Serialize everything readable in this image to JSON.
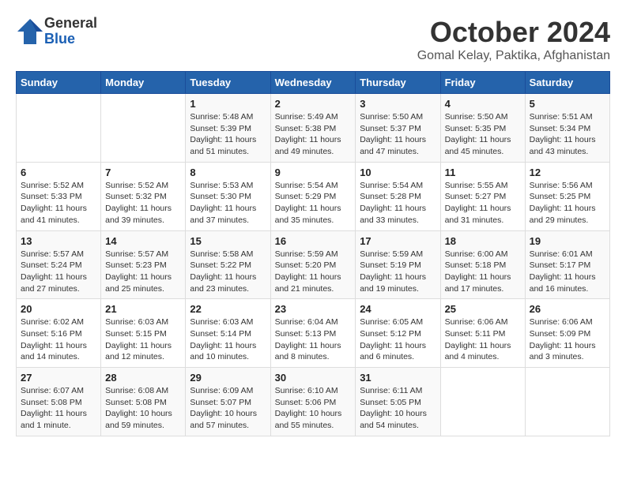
{
  "logo": {
    "general": "General",
    "blue": "Blue"
  },
  "header": {
    "month": "October 2024",
    "location": "Gomal Kelay, Paktika, Afghanistan"
  },
  "weekdays": [
    "Sunday",
    "Monday",
    "Tuesday",
    "Wednesday",
    "Thursday",
    "Friday",
    "Saturday"
  ],
  "weeks": [
    [
      {
        "day": "",
        "info": ""
      },
      {
        "day": "",
        "info": ""
      },
      {
        "day": "1",
        "info": "Sunrise: 5:48 AM\nSunset: 5:39 PM\nDaylight: 11 hours and 51 minutes."
      },
      {
        "day": "2",
        "info": "Sunrise: 5:49 AM\nSunset: 5:38 PM\nDaylight: 11 hours and 49 minutes."
      },
      {
        "day": "3",
        "info": "Sunrise: 5:50 AM\nSunset: 5:37 PM\nDaylight: 11 hours and 47 minutes."
      },
      {
        "day": "4",
        "info": "Sunrise: 5:50 AM\nSunset: 5:35 PM\nDaylight: 11 hours and 45 minutes."
      },
      {
        "day": "5",
        "info": "Sunrise: 5:51 AM\nSunset: 5:34 PM\nDaylight: 11 hours and 43 minutes."
      }
    ],
    [
      {
        "day": "6",
        "info": "Sunrise: 5:52 AM\nSunset: 5:33 PM\nDaylight: 11 hours and 41 minutes."
      },
      {
        "day": "7",
        "info": "Sunrise: 5:52 AM\nSunset: 5:32 PM\nDaylight: 11 hours and 39 minutes."
      },
      {
        "day": "8",
        "info": "Sunrise: 5:53 AM\nSunset: 5:30 PM\nDaylight: 11 hours and 37 minutes."
      },
      {
        "day": "9",
        "info": "Sunrise: 5:54 AM\nSunset: 5:29 PM\nDaylight: 11 hours and 35 minutes."
      },
      {
        "day": "10",
        "info": "Sunrise: 5:54 AM\nSunset: 5:28 PM\nDaylight: 11 hours and 33 minutes."
      },
      {
        "day": "11",
        "info": "Sunrise: 5:55 AM\nSunset: 5:27 PM\nDaylight: 11 hours and 31 minutes."
      },
      {
        "day": "12",
        "info": "Sunrise: 5:56 AM\nSunset: 5:25 PM\nDaylight: 11 hours and 29 minutes."
      }
    ],
    [
      {
        "day": "13",
        "info": "Sunrise: 5:57 AM\nSunset: 5:24 PM\nDaylight: 11 hours and 27 minutes."
      },
      {
        "day": "14",
        "info": "Sunrise: 5:57 AM\nSunset: 5:23 PM\nDaylight: 11 hours and 25 minutes."
      },
      {
        "day": "15",
        "info": "Sunrise: 5:58 AM\nSunset: 5:22 PM\nDaylight: 11 hours and 23 minutes."
      },
      {
        "day": "16",
        "info": "Sunrise: 5:59 AM\nSunset: 5:20 PM\nDaylight: 11 hours and 21 minutes."
      },
      {
        "day": "17",
        "info": "Sunrise: 5:59 AM\nSunset: 5:19 PM\nDaylight: 11 hours and 19 minutes."
      },
      {
        "day": "18",
        "info": "Sunrise: 6:00 AM\nSunset: 5:18 PM\nDaylight: 11 hours and 17 minutes."
      },
      {
        "day": "19",
        "info": "Sunrise: 6:01 AM\nSunset: 5:17 PM\nDaylight: 11 hours and 16 minutes."
      }
    ],
    [
      {
        "day": "20",
        "info": "Sunrise: 6:02 AM\nSunset: 5:16 PM\nDaylight: 11 hours and 14 minutes."
      },
      {
        "day": "21",
        "info": "Sunrise: 6:03 AM\nSunset: 5:15 PM\nDaylight: 11 hours and 12 minutes."
      },
      {
        "day": "22",
        "info": "Sunrise: 6:03 AM\nSunset: 5:14 PM\nDaylight: 11 hours and 10 minutes."
      },
      {
        "day": "23",
        "info": "Sunrise: 6:04 AM\nSunset: 5:13 PM\nDaylight: 11 hours and 8 minutes."
      },
      {
        "day": "24",
        "info": "Sunrise: 6:05 AM\nSunset: 5:12 PM\nDaylight: 11 hours and 6 minutes."
      },
      {
        "day": "25",
        "info": "Sunrise: 6:06 AM\nSunset: 5:11 PM\nDaylight: 11 hours and 4 minutes."
      },
      {
        "day": "26",
        "info": "Sunrise: 6:06 AM\nSunset: 5:09 PM\nDaylight: 11 hours and 3 minutes."
      }
    ],
    [
      {
        "day": "27",
        "info": "Sunrise: 6:07 AM\nSunset: 5:08 PM\nDaylight: 11 hours and 1 minute."
      },
      {
        "day": "28",
        "info": "Sunrise: 6:08 AM\nSunset: 5:08 PM\nDaylight: 10 hours and 59 minutes."
      },
      {
        "day": "29",
        "info": "Sunrise: 6:09 AM\nSunset: 5:07 PM\nDaylight: 10 hours and 57 minutes."
      },
      {
        "day": "30",
        "info": "Sunrise: 6:10 AM\nSunset: 5:06 PM\nDaylight: 10 hours and 55 minutes."
      },
      {
        "day": "31",
        "info": "Sunrise: 6:11 AM\nSunset: 5:05 PM\nDaylight: 10 hours and 54 minutes."
      },
      {
        "day": "",
        "info": ""
      },
      {
        "day": "",
        "info": ""
      }
    ]
  ]
}
